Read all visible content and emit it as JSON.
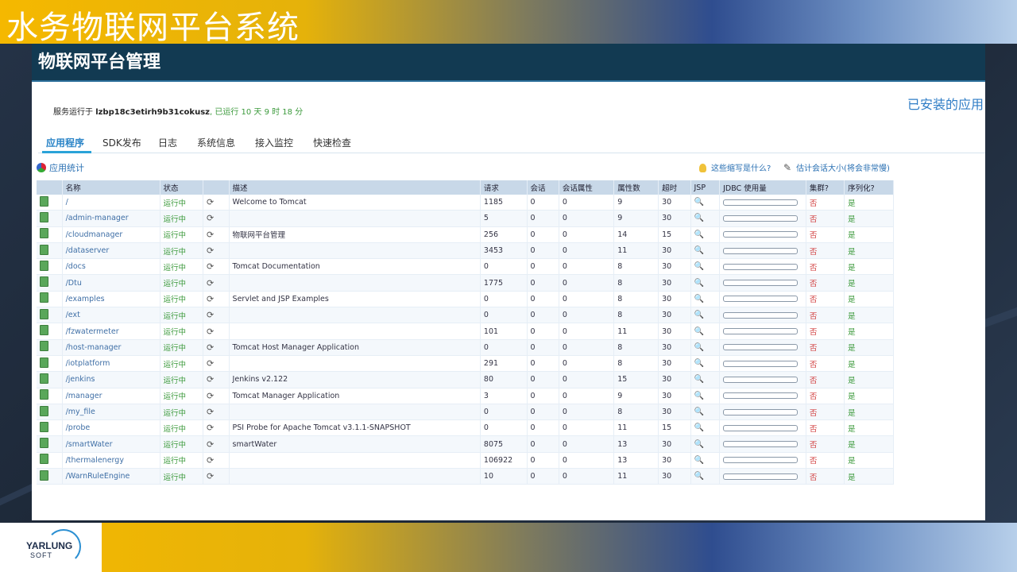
{
  "banner": {
    "title": "水务物联网平台系统"
  },
  "app": {
    "header_title": "物联网平台管理",
    "run_prefix": "服务运行于",
    "host": "lzbp18c3etirh9b31cokusz",
    "uptime": ", 已运行 10 天 9 时 18 分",
    "installed_apps": "已安装的应用"
  },
  "tabs": [
    "应用程序",
    "SDK发布",
    "日志",
    "系统信息",
    "接入监控",
    "快速检查"
  ],
  "toolbar": {
    "stats": "应用统计",
    "hint_abbrev": "这些缩写是什么?",
    "hint_session": "估计会话大小(将会非常慢)"
  },
  "columns": [
    "名称",
    "状态",
    "",
    "描述",
    "请求",
    "会话",
    "会话属性",
    "属性数",
    "超时",
    "JSP",
    "JDBC 使用量",
    "集群?",
    "序列化?"
  ],
  "status_label": "运行中",
  "cluster_label": "否",
  "serial_label": "是",
  "rows": [
    {
      "name": "/",
      "desc": "Welcome to Tomcat",
      "req": "1185",
      "sess": "0",
      "attr": "0",
      "props": "9",
      "timeout": "30"
    },
    {
      "name": "/admin-manager",
      "desc": "",
      "req": "5",
      "sess": "0",
      "attr": "0",
      "props": "9",
      "timeout": "30"
    },
    {
      "name": "/cloudmanager",
      "desc": "物联网平台管理",
      "req": "256",
      "sess": "0",
      "attr": "0",
      "props": "14",
      "timeout": "15"
    },
    {
      "name": "/dataserver",
      "desc": "",
      "req": "3453",
      "sess": "0",
      "attr": "0",
      "props": "11",
      "timeout": "30"
    },
    {
      "name": "/docs",
      "desc": "Tomcat Documentation",
      "req": "0",
      "sess": "0",
      "attr": "0",
      "props": "8",
      "timeout": "30"
    },
    {
      "name": "/Dtu",
      "desc": "",
      "req": "1775",
      "sess": "0",
      "attr": "0",
      "props": "8",
      "timeout": "30"
    },
    {
      "name": "/examples",
      "desc": "Servlet and JSP Examples",
      "req": "0",
      "sess": "0",
      "attr": "0",
      "props": "8",
      "timeout": "30"
    },
    {
      "name": "/ext",
      "desc": "",
      "req": "0",
      "sess": "0",
      "attr": "0",
      "props": "8",
      "timeout": "30"
    },
    {
      "name": "/fzwatermeter",
      "desc": "",
      "req": "101",
      "sess": "0",
      "attr": "0",
      "props": "11",
      "timeout": "30"
    },
    {
      "name": "/host-manager",
      "desc": "Tomcat Host Manager Application",
      "req": "0",
      "sess": "0",
      "attr": "0",
      "props": "8",
      "timeout": "30"
    },
    {
      "name": "/iotplatform",
      "desc": "",
      "req": "291",
      "sess": "0",
      "attr": "0",
      "props": "8",
      "timeout": "30"
    },
    {
      "name": "/jenkins",
      "desc": "Jenkins v2.122",
      "req": "80",
      "sess": "0",
      "attr": "0",
      "props": "15",
      "timeout": "30"
    },
    {
      "name": "/manager",
      "desc": "Tomcat Manager Application",
      "req": "3",
      "sess": "0",
      "attr": "0",
      "props": "9",
      "timeout": "30"
    },
    {
      "name": "/my_file",
      "desc": "",
      "req": "0",
      "sess": "0",
      "attr": "0",
      "props": "8",
      "timeout": "30"
    },
    {
      "name": "/probe",
      "desc": "PSI Probe for Apache Tomcat v3.1.1-SNAPSHOT",
      "req": "0",
      "sess": "0",
      "attr": "0",
      "props": "11",
      "timeout": "15"
    },
    {
      "name": "/smartWater",
      "desc": "smartWater",
      "req": "8075",
      "sess": "0",
      "attr": "0",
      "props": "13",
      "timeout": "30"
    },
    {
      "name": "/thermalenergy",
      "desc": "",
      "req": "106922",
      "sess": "0",
      "attr": "0",
      "props": "13",
      "timeout": "30"
    },
    {
      "name": "/WarnRuleEngine",
      "desc": "",
      "req": "10",
      "sess": "0",
      "attr": "0",
      "props": "11",
      "timeout": "30"
    }
  ],
  "logo": {
    "name": "YARLUNG",
    "sub": "SOFT"
  },
  "colors": {
    "banner_start": "#f5b800",
    "banner_end": "#b7cfea",
    "header_bg": "#123a52",
    "status_green": "#3c9a3c",
    "no_red": "#d03a3a"
  }
}
